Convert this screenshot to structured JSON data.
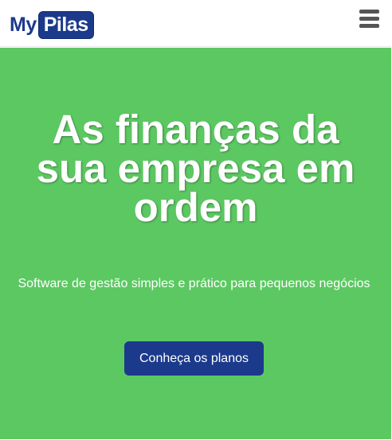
{
  "header": {
    "logo": {
      "prefix": "My",
      "badge": "Pilas"
    },
    "menu_icon": "hamburger-menu-icon"
  },
  "hero": {
    "title": "As finanças da sua empresa em ordem",
    "subtitle": "Software de gestão simples e prático para pequenos negócios",
    "cta_label": "Conheça os planos"
  },
  "colors": {
    "brand_blue": "#1b3a8c",
    "hero_green": "#5cc862",
    "menu_gray": "#555555",
    "text_white": "#ffffff"
  }
}
